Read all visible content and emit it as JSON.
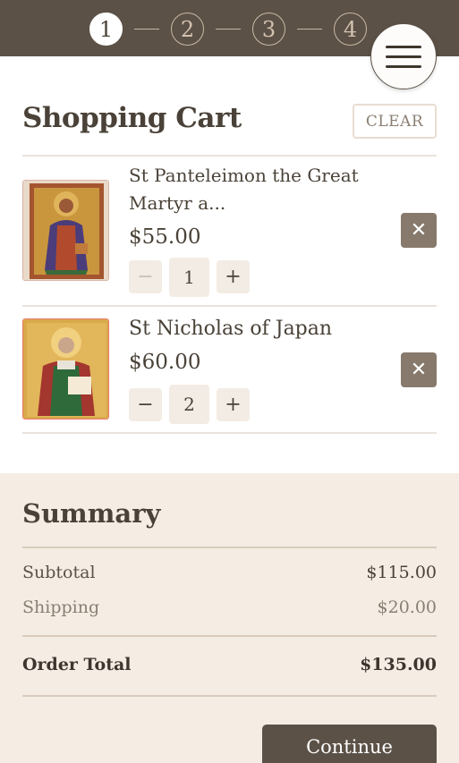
{
  "steps": [
    "1",
    "2",
    "3",
    "4"
  ],
  "active_step": "1",
  "cart": {
    "title": "Shopping Cart",
    "clear_label": "CLEAR",
    "items": [
      {
        "name": "St Panteleimon the Great Martyr a...",
        "price": "$55.00",
        "quantity": "1"
      },
      {
        "name": "St Nicholas of Japan",
        "price": "$60.00",
        "quantity": "2"
      }
    ]
  },
  "summary": {
    "title": "Summary",
    "subtotal_label": "Subtotal",
    "subtotal_value": "$115.00",
    "shipping_label": "Shipping",
    "shipping_value": "$20.00",
    "total_label": "Order Total",
    "total_value": "$135.00",
    "continue_label": "Continue"
  },
  "colors": {
    "header_bg": "#5c5147",
    "summary_bg": "#f5ede4",
    "remove_button": "#877a6c"
  },
  "icons": {
    "menu": "hamburger-icon",
    "remove": "close-icon",
    "minus": "minus-icon",
    "plus": "plus-icon"
  }
}
